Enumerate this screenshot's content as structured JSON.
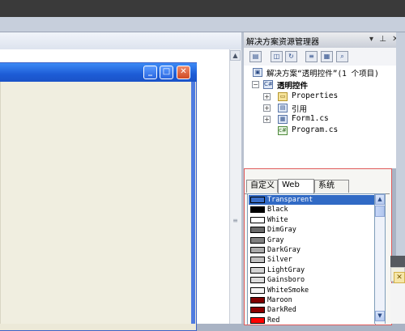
{
  "solution_explorer": {
    "title": "解决方案资源管理器",
    "title_buttons": "▾ ⊥ ✕",
    "toolbar_icons": [
      "properties-icon",
      "show-all-files-icon",
      "refresh-icon",
      "view-code-icon",
      "view-designer-icon",
      "class-diagram-icon"
    ],
    "solution_label": "解决方案“透明控件”(1 个项目)",
    "project_label": "透明控件",
    "items": [
      {
        "label": "Properties",
        "icon": "folder-icon",
        "expander": "+"
      },
      {
        "label": "引用",
        "icon": "references-icon",
        "expander": "+"
      },
      {
        "label": "Form1.cs",
        "icon": "form-icon",
        "expander": "+"
      },
      {
        "label": "Program.cs",
        "icon": "csharp-file-icon",
        "expander": ""
      }
    ]
  },
  "color_picker": {
    "tabs": [
      {
        "label": "自定义",
        "active": false
      },
      {
        "label": "Web",
        "active": true
      },
      {
        "label": "系统",
        "active": false
      }
    ],
    "colors": [
      {
        "name": "Transparent",
        "swatch": "#3a6fc9",
        "selected": true
      },
      {
        "name": "Black",
        "swatch": "#000000",
        "selected": false
      },
      {
        "name": "White",
        "swatch": "#ffffff",
        "selected": false
      },
      {
        "name": "DimGray",
        "swatch": "#696969",
        "selected": false
      },
      {
        "name": "Gray",
        "swatch": "#808080",
        "selected": false
      },
      {
        "name": "DarkGray",
        "swatch": "#a9a9a9",
        "selected": false
      },
      {
        "name": "Silver",
        "swatch": "#c0c0c0",
        "selected": false
      },
      {
        "name": "LightGray",
        "swatch": "#d3d3d3",
        "selected": false
      },
      {
        "name": "Gainsboro",
        "swatch": "#dcdcdc",
        "selected": false
      },
      {
        "name": "WhiteSmoke",
        "swatch": "#f5f5f5",
        "selected": false
      },
      {
        "name": "Maroon",
        "swatch": "#800000",
        "selected": false
      },
      {
        "name": "DarkRed",
        "swatch": "#8b0000",
        "selected": false
      },
      {
        "name": "Red",
        "swatch": "#ff0000",
        "selected": false
      }
    ]
  },
  "form_window": {
    "buttons": {
      "minimize": "_",
      "maximize": "□",
      "close": "✕"
    }
  },
  "colors": {
    "xp_title_blue": "#1d5cd6",
    "selection_blue": "#316ac5",
    "picker_border": "#e05a5a"
  }
}
